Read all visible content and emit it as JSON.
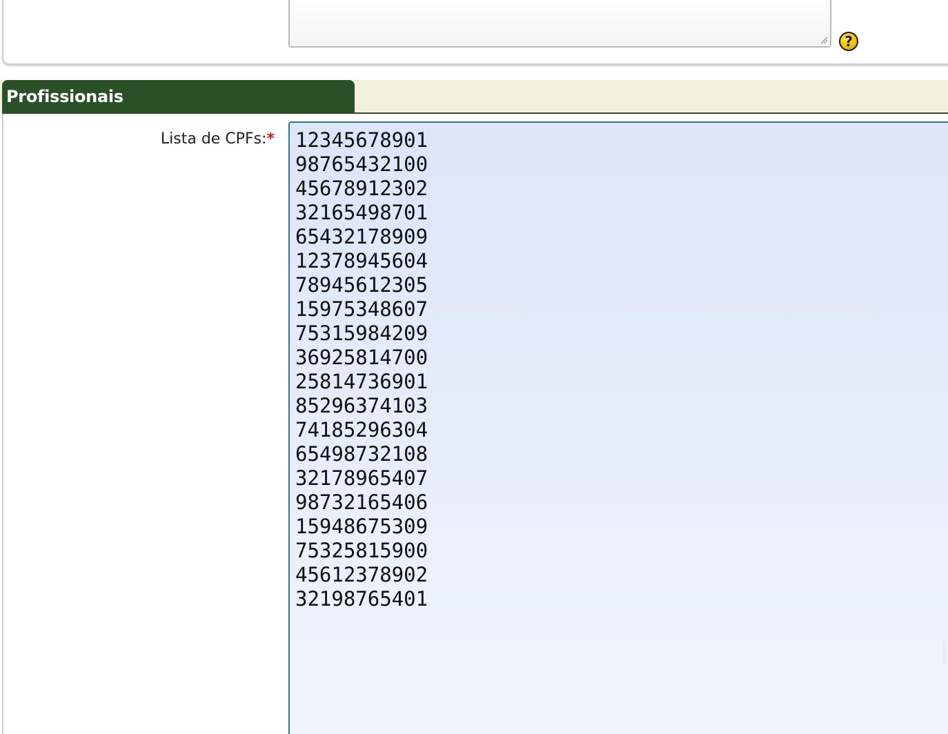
{
  "previous_section": {
    "help_icon_glyph": "?"
  },
  "professionals_section": {
    "title": "Profissionais",
    "cpf_field": {
      "label": "Lista de CPFs:",
      "required_marker": "*",
      "value": "12345678901\n98765432100\n45678912302\n32165498701\n65432178909\n12378945604\n78945612305\n15975348607\n75315984209\n36925814700\n25814736901\n85296374103\n74185296304\n65498732108\n32178965407\n98732165406\n15948675309\n75325815900\n45612378902\n32198765401"
    }
  },
  "colors": {
    "section_header": "#2b4f27",
    "section_band": "#f3f1dc",
    "required": "#d11a1a",
    "focused_field_border": "#3f6f8f",
    "focused_field_bg": "#dbe6f9"
  }
}
